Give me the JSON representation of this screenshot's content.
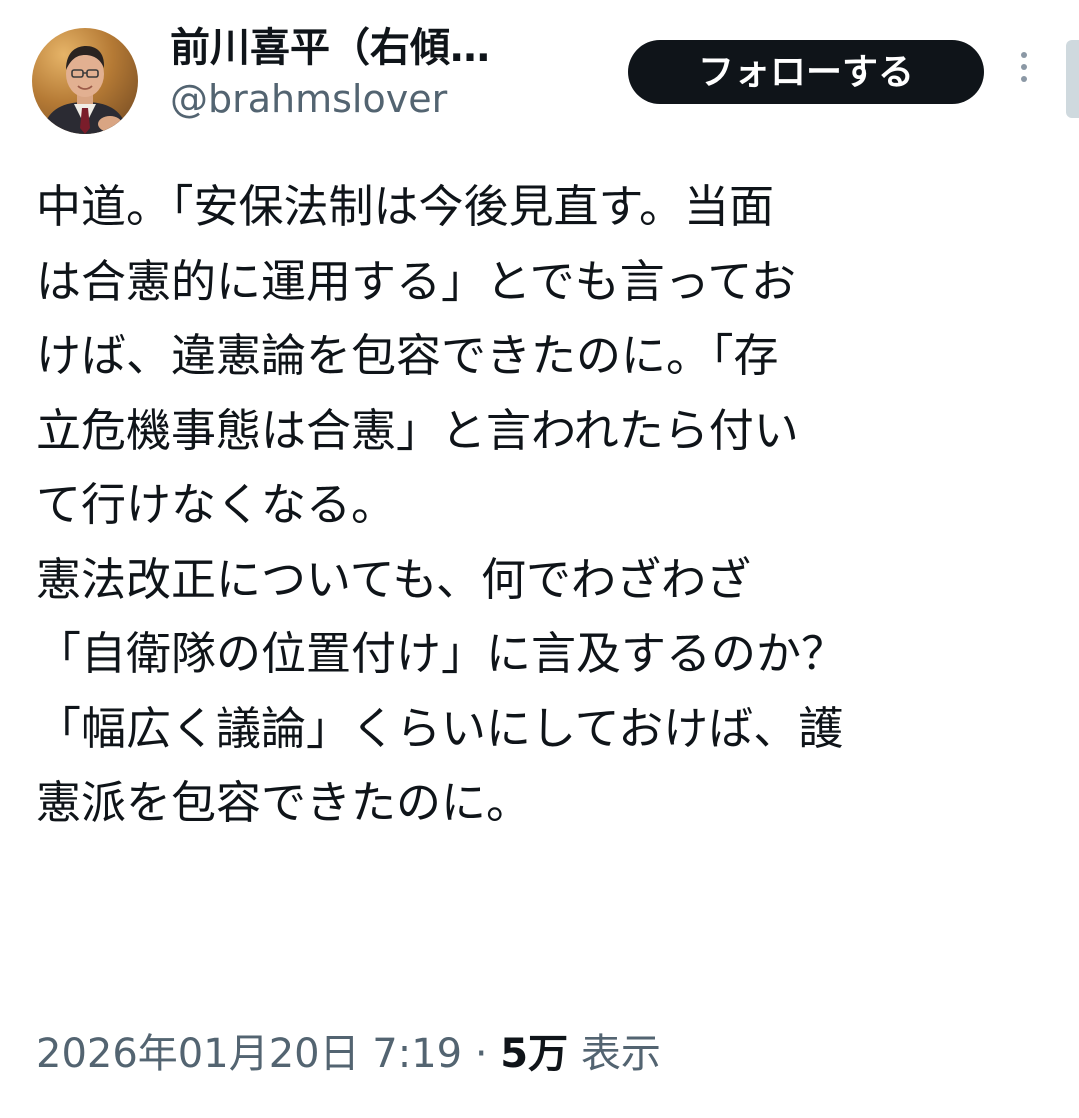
{
  "author": {
    "display_name": "前川喜平（右傾…",
    "handle": "@brahmslover"
  },
  "follow_label": "フォローする",
  "tweet_lines": [
    "中道。「安保法制は今後見直す。当面",
    "は合憲的に運用する」とでも言ってお",
    "けば、違憲論を包容できたのに。「存",
    "立危機事態は合憲」と言われたら付い",
    "て行けなくなる。",
    "憲法改正についても、何でわざわざ",
    "「自衛隊の位置付け」に言及するのか？",
    "「幅広く議論」くらいにしておけば、護",
    "憲派を包容できたのに。"
  ],
  "meta": {
    "timestamp": "2026年01月20日 7:19",
    "separator": "·",
    "views_count": "5万",
    "views_label": "表示"
  },
  "icons": {
    "more": "more-vertical-icon",
    "avatar": "profile-photo"
  },
  "colors": {
    "follow_button_bg": "#0f1419",
    "secondary_text": "#536471",
    "primary_text": "#0f1419"
  }
}
